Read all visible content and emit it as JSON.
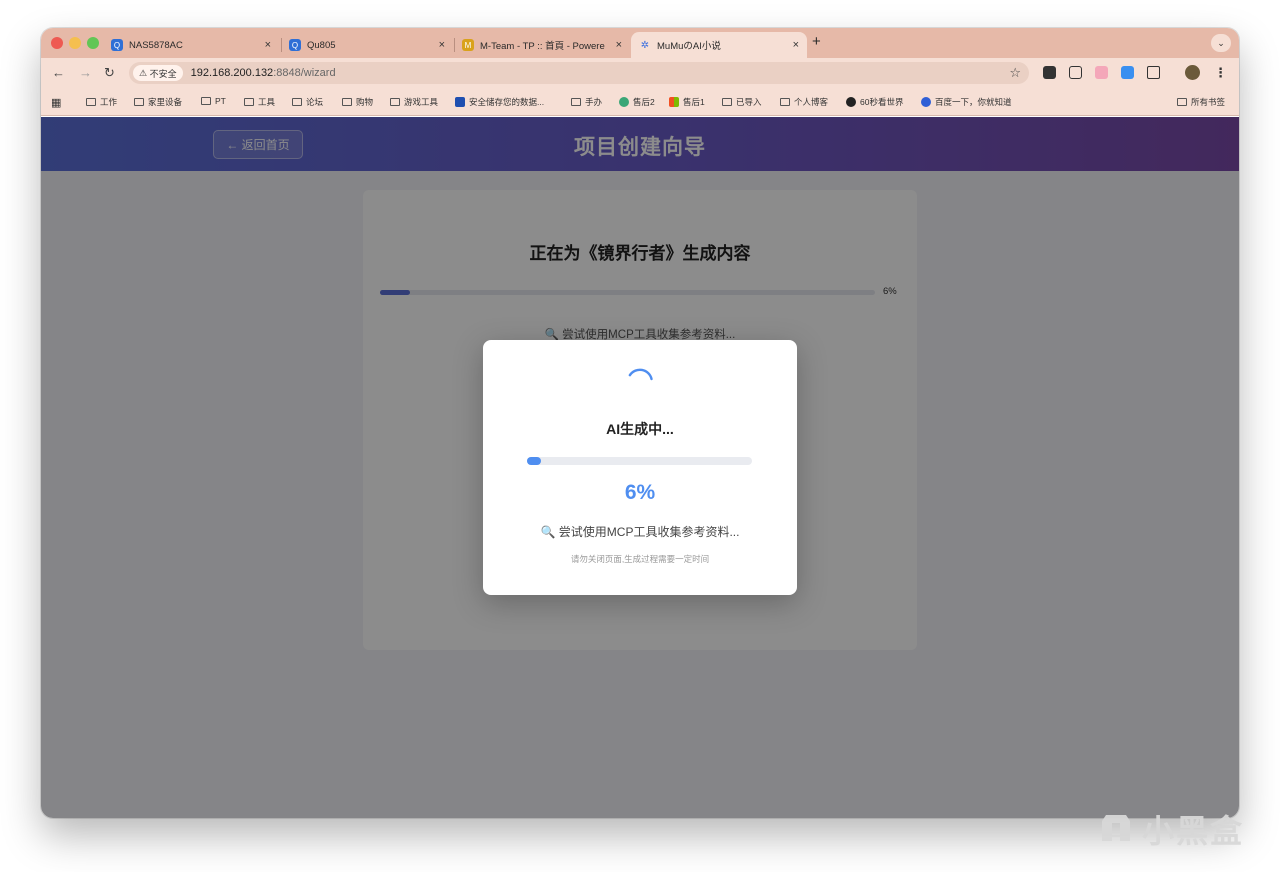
{
  "browser": {
    "tabs": [
      {
        "title": "NAS5878AC",
        "icon": "qnap-icon",
        "color": "#2f6fd6"
      },
      {
        "title": "Qu805",
        "icon": "qnap-icon",
        "color": "#2f6fd6"
      },
      {
        "title": "M-Team - TP :: 首頁 - Powere",
        "icon": "mteam-icon",
        "color": "#d9a21b"
      },
      {
        "title": "MuMuのAI小说",
        "icon": "butterfly-icon",
        "color": "#3b6fe0",
        "active": true
      }
    ],
    "new_tab_label": "+",
    "tab_close": "×",
    "security_label": "不安全",
    "url_host": "192.168.200.132",
    "url_path": ":8848/wizard",
    "bookmarks": [
      {
        "label": "工作",
        "icon": "folder-icon"
      },
      {
        "label": "家里设备",
        "icon": "folder-icon"
      },
      {
        "label": "PT",
        "icon": "folder-icon"
      },
      {
        "label": "工具",
        "icon": "folder-icon"
      },
      {
        "label": "论坛",
        "icon": "folder-icon"
      },
      {
        "label": "购物",
        "icon": "folder-icon"
      },
      {
        "label": "游戏工具",
        "icon": "folder-icon"
      },
      {
        "label": "安全储存您的数据...",
        "icon": "app-icon"
      },
      {
        "label": "手办",
        "icon": "folder-icon"
      },
      {
        "label": "售后2",
        "icon": "app-icon"
      },
      {
        "label": "售后1",
        "icon": "app-icon"
      },
      {
        "label": "已导入",
        "icon": "folder-icon"
      },
      {
        "label": "个人博客",
        "icon": "folder-icon"
      },
      {
        "label": "60秒看世界",
        "icon": "app-icon"
      },
      {
        "label": "百度一下，你就知道",
        "icon": "baidu-icon"
      }
    ],
    "all_bookmarks_label": "所有书签"
  },
  "app": {
    "back_button": "← 返回首页",
    "page_title": "项目创建向导",
    "card_title": "正在为《镜界行者》生成内容",
    "card_progress_label": "6%",
    "card_status": "🔍 尝试使用MCP工具收集参考资料..."
  },
  "modal": {
    "title": "AI生成中...",
    "progress": 0.06,
    "percent_label": "6%",
    "status": "🔍 尝试使用MCP工具收集参考资料...",
    "hint": "请勿关闭页面,生成过程需要一定时间"
  },
  "watermark": "小黑盒",
  "colors": {
    "accent_blue": "#4f8ef0",
    "header_gradient_start": "#5a6fd8",
    "header_gradient_end": "#7a4aa8"
  }
}
